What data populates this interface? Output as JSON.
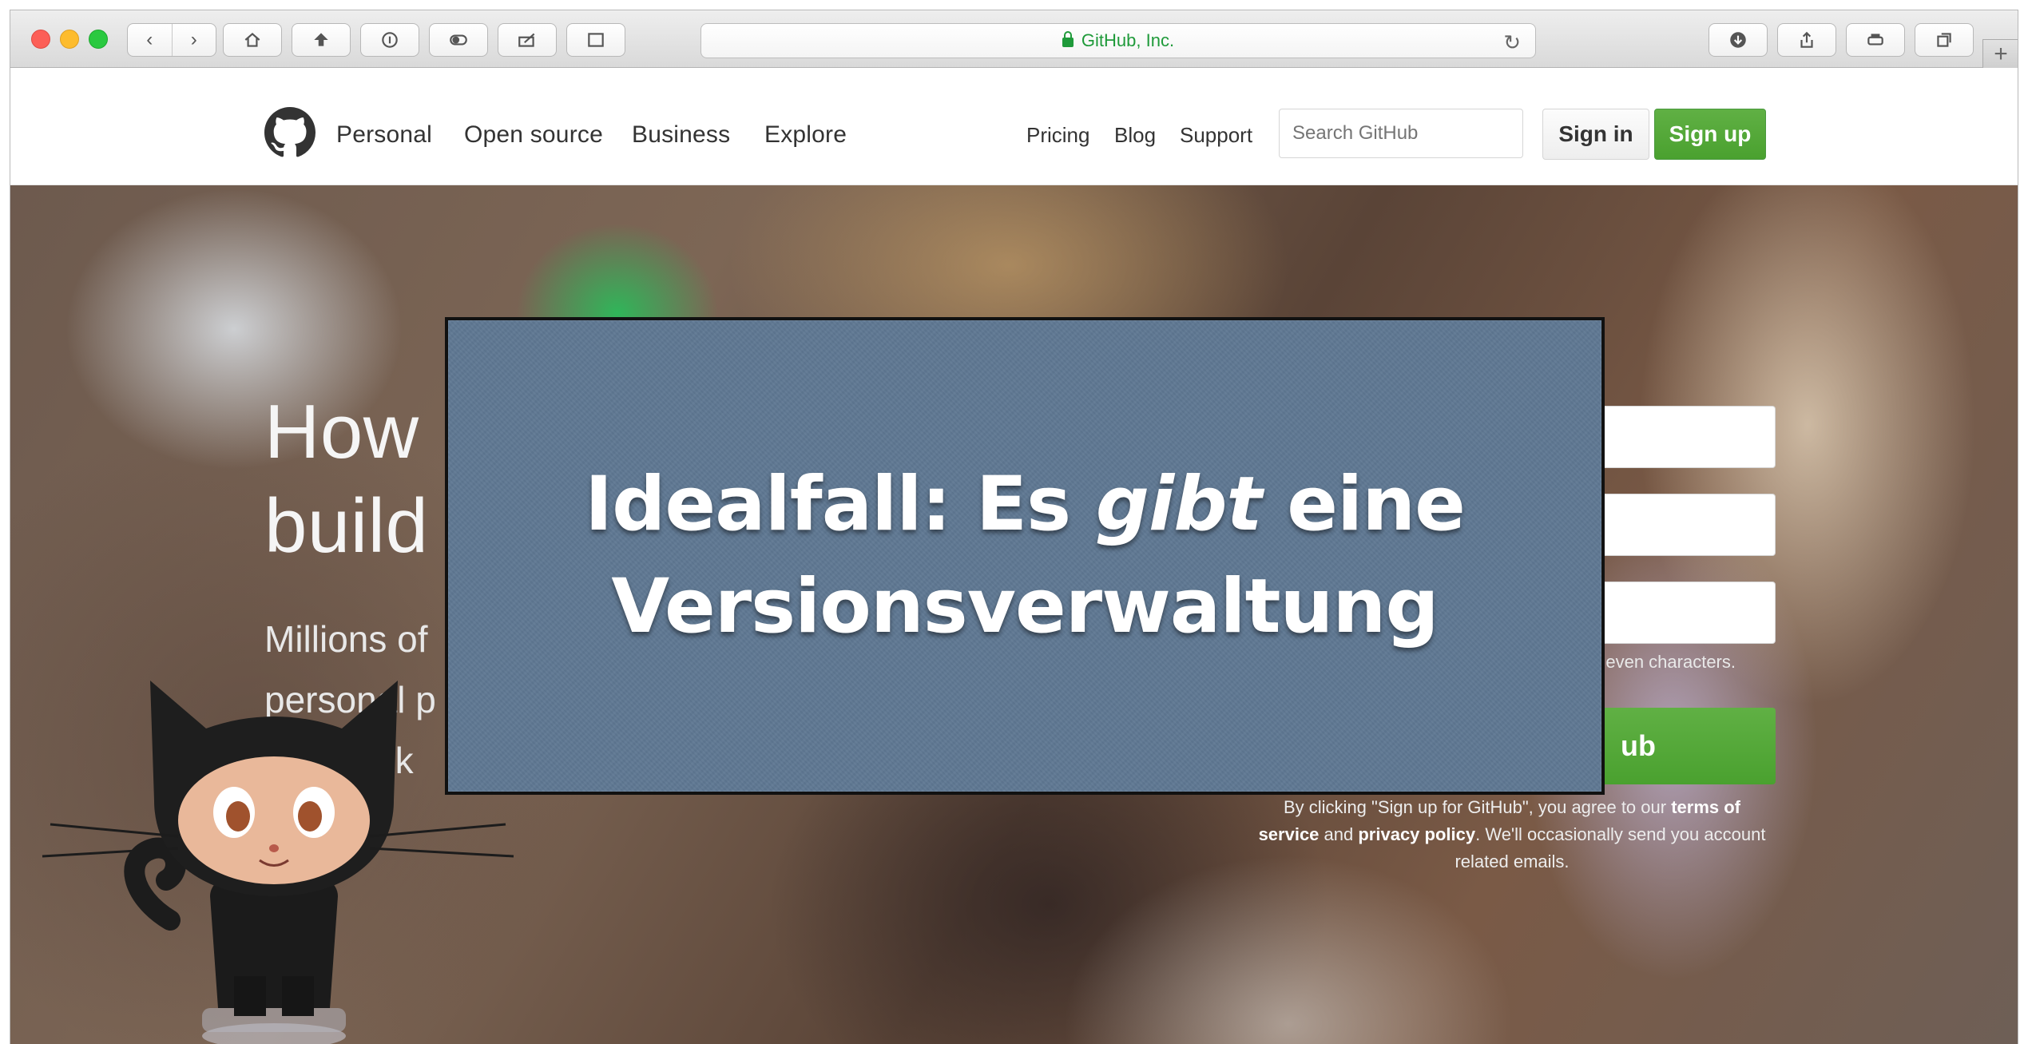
{
  "browser": {
    "address": "GitHub, Inc."
  },
  "header": {
    "nav": [
      "Personal",
      "Open source",
      "Business",
      "Explore"
    ],
    "links": [
      "Pricing",
      "Blog",
      "Support"
    ],
    "search_placeholder": "Search GitHub",
    "signin_label": "Sign in",
    "signup_label": "Sign up"
  },
  "hero": {
    "title_line1": "How",
    "title_line2": "build",
    "sub_line1": "Millions of",
    "sub_line2": "personal p",
    "sub_line3": "and work",
    "password_hint": "even characters.",
    "signup_button": "ub",
    "terms_line1_a": "By clicking \"Sign up for GitHub\", you agree to our ",
    "terms_line1_b": "terms of",
    "terms_line2_a": "service",
    "terms_line2_b": " and ",
    "terms_line2_c": "privacy policy",
    "terms_line2_d": ". We'll occasionally send you account",
    "terms_line3": "related emails."
  },
  "overlay": {
    "line1_a": "Idealfall: Es ",
    "line1_em": "gibt",
    "line1_b": " eine",
    "line2": "Versionsverwaltung",
    "background_color": "#5f7893"
  }
}
